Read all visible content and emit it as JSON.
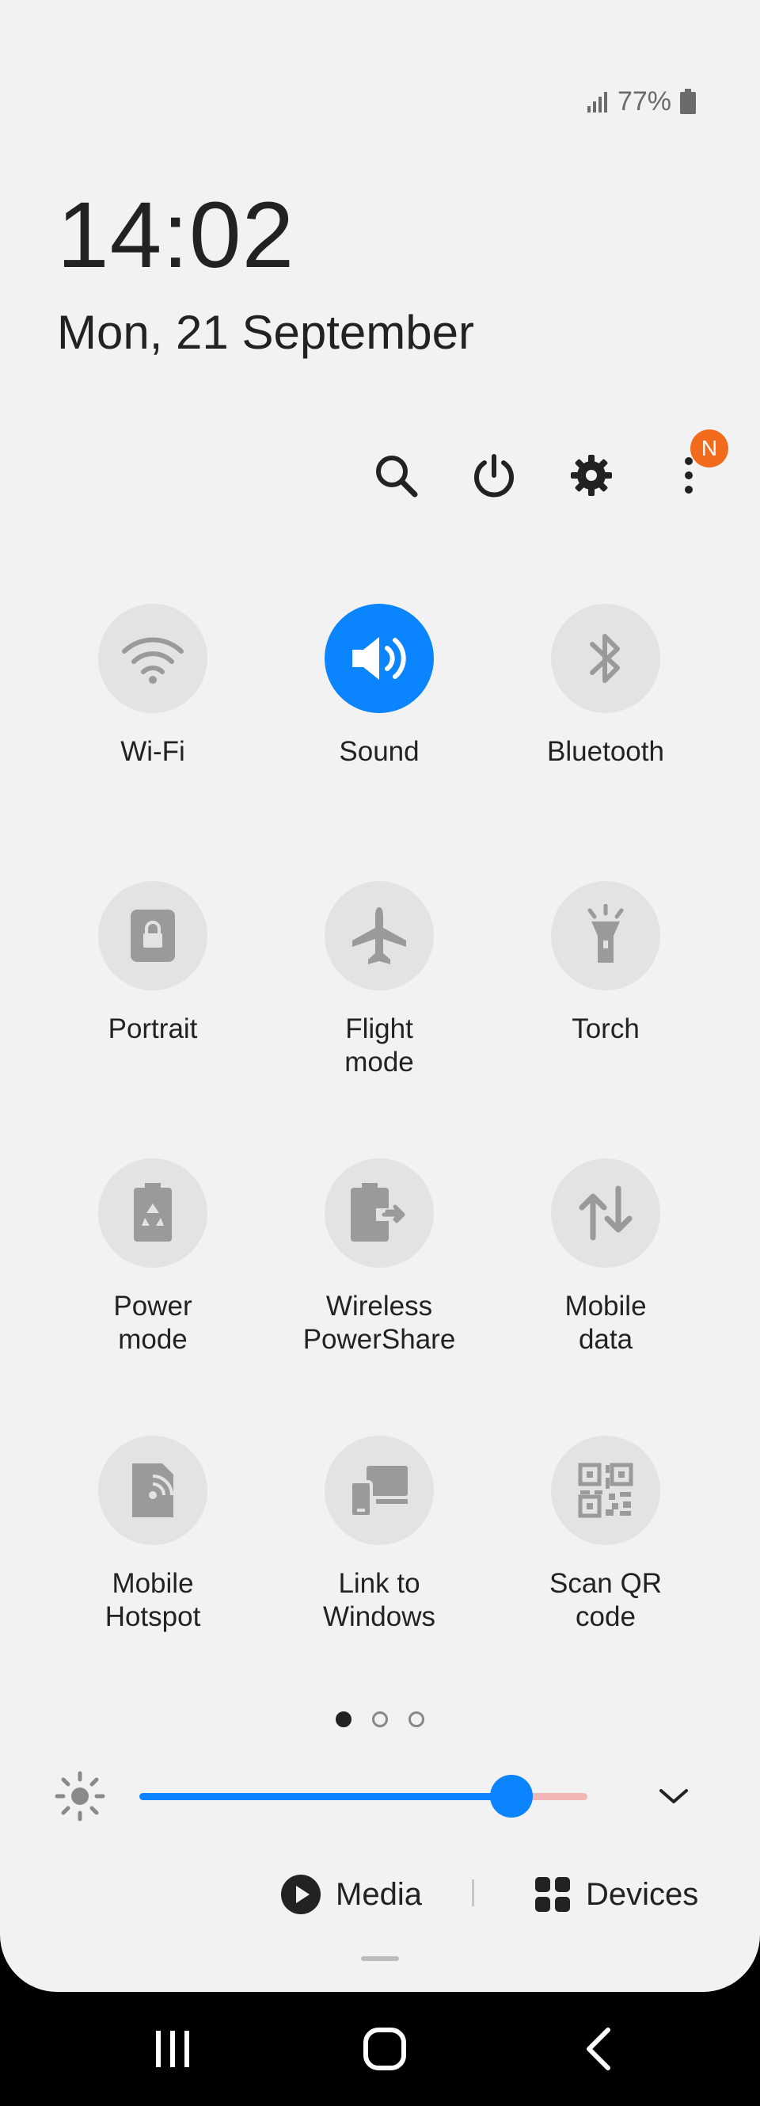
{
  "status": {
    "battery": "77%"
  },
  "clock": {
    "time": "14:02",
    "date": "Mon, 21 September"
  },
  "toolbar": {
    "search": "search-icon",
    "power": "power-icon",
    "settings": "gear-icon",
    "more": "more-vertical-icon",
    "notification_badge": "N"
  },
  "tiles": [
    {
      "label": "Wi-Fi",
      "icon": "wifi-icon",
      "on": false
    },
    {
      "label": "Sound",
      "icon": "sound-icon",
      "on": true
    },
    {
      "label": "Bluetooth",
      "icon": "bluetooth-icon",
      "on": false
    },
    {
      "label": "Portrait",
      "icon": "portrait-lock-icon",
      "on": false
    },
    {
      "label": "Flight\nmode",
      "icon": "airplane-icon",
      "on": false
    },
    {
      "label": "Torch",
      "icon": "torch-icon",
      "on": false
    },
    {
      "label": "Power\nmode",
      "icon": "power-mode-icon",
      "on": false
    },
    {
      "label": "Wireless\nPowerShare",
      "icon": "wireless-powershare-icon",
      "on": false
    },
    {
      "label": "Mobile\ndata",
      "icon": "mobile-data-icon",
      "on": false
    },
    {
      "label": "Mobile\nHotspot",
      "icon": "hotspot-icon",
      "on": false
    },
    {
      "label": "Link to\nWindows",
      "icon": "link-to-windows-icon",
      "on": false
    },
    {
      "label": "Scan QR\ncode",
      "icon": "qr-code-icon",
      "on": false
    }
  ],
  "page_indicator": {
    "pages": 3,
    "current": 1
  },
  "brightness": {
    "level": 0.83
  },
  "media": {
    "media_label": "Media",
    "devices_label": "Devices"
  },
  "colors": {
    "accent": "#0a84ff",
    "badge": "#f26b1d",
    "panel": "#f2f2f2"
  }
}
